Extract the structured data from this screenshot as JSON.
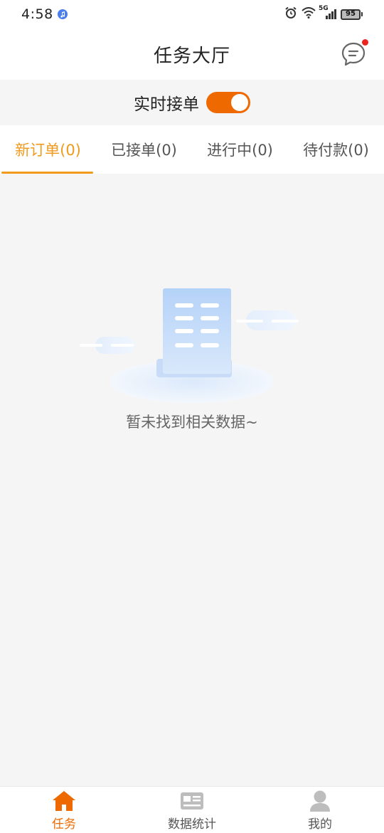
{
  "status_bar": {
    "time": "4:58",
    "network": "5G",
    "battery": "95"
  },
  "header": {
    "title": "任务大厅",
    "message_icon": "chat-bubble-icon",
    "has_notification": true
  },
  "realtime": {
    "label": "实时接单",
    "enabled": true
  },
  "tabs": [
    {
      "label": "新订单(0)",
      "active": true
    },
    {
      "label": "已接单(0)",
      "active": false
    },
    {
      "label": "进行中(0)",
      "active": false
    },
    {
      "label": "待付款(0)",
      "active": false
    }
  ],
  "empty_state": {
    "message": "暂未找到相关数据~"
  },
  "bottom_nav": [
    {
      "label": "任务",
      "icon": "home-icon",
      "active": true
    },
    {
      "label": "数据统计",
      "icon": "stats-card-icon",
      "active": false
    },
    {
      "label": "我的",
      "icon": "person-icon",
      "active": false
    }
  ],
  "colors": {
    "accent": "#ee6a00",
    "tab_active": "#f09a1e",
    "notification": "#e8251f"
  }
}
